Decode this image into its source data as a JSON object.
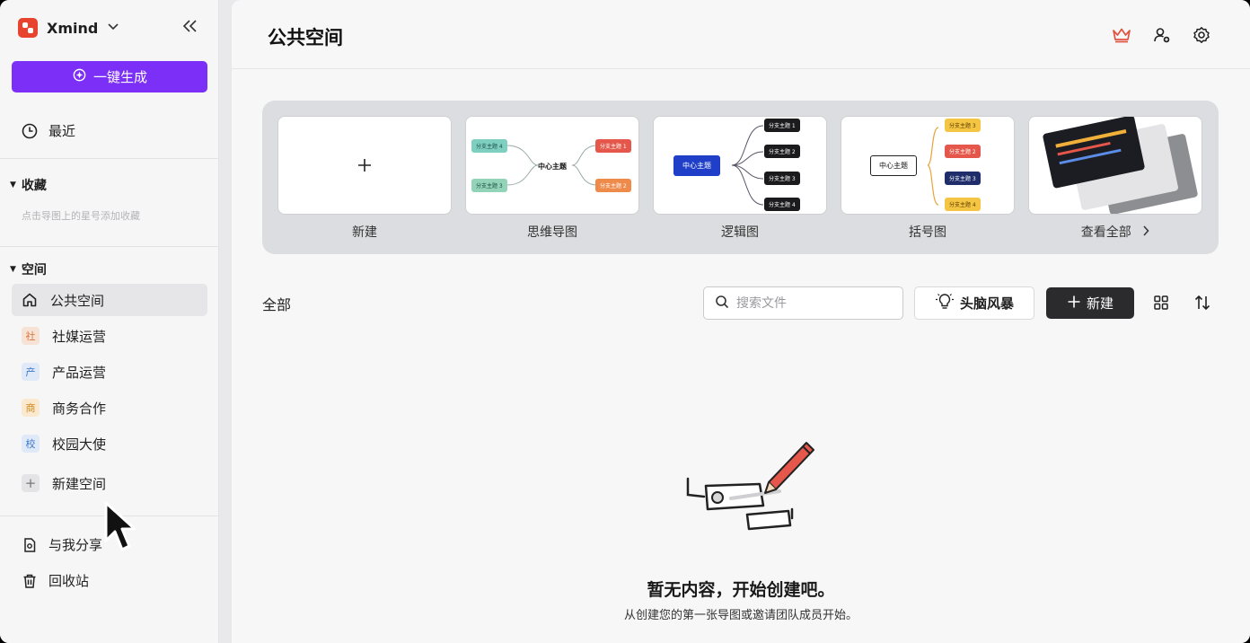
{
  "app": {
    "name": "Xmind",
    "brand_color": "#e8432f",
    "accent": "#7b2ff7"
  },
  "sidebar": {
    "generate_label": "一键生成",
    "recent_label": "最近",
    "favorites": {
      "title": "收藏",
      "hint": "点击导图上的星号添加收藏"
    },
    "spaces": {
      "title": "空间",
      "items": [
        {
          "label": "公共空间",
          "icon": "home-icon"
        },
        {
          "label": "社媒运营",
          "badge": "社",
          "color": "#f7e3d6",
          "badge_color": "#d9743a"
        },
        {
          "label": "产品运营",
          "badge": "产",
          "color": "#dfe9f8",
          "badge_color": "#3f78c8"
        },
        {
          "label": "商务合作",
          "badge": "商",
          "color": "#fbe9cf",
          "badge_color": "#d18a1e"
        },
        {
          "label": "校园大使",
          "badge": "校",
          "color": "#dfe9f8",
          "badge_color": "#3f78c8"
        }
      ],
      "new_space_label": "新建空间"
    },
    "shared_label": "与我分享",
    "trash_label": "回收站"
  },
  "main": {
    "title": "公共空间",
    "templates": [
      {
        "label": "新建"
      },
      {
        "label": "思维导图"
      },
      {
        "label": "逻辑图"
      },
      {
        "label": "括号图"
      },
      {
        "label": "查看全部"
      }
    ],
    "mindmap_preview": {
      "center": "中心主题",
      "b1": "分支主题 1",
      "b2": "分支主题 2",
      "b3": "分支主题 3",
      "b4": "分支主题 4"
    },
    "all_label": "全部",
    "search_placeholder": "搜索文件",
    "brainstorm_label": "头脑风暴",
    "new_label": "新建",
    "empty_title": "暂无内容，开始创建吧。",
    "empty_sub": "从创建您的第一张导图或邀请团队成员开始。"
  }
}
